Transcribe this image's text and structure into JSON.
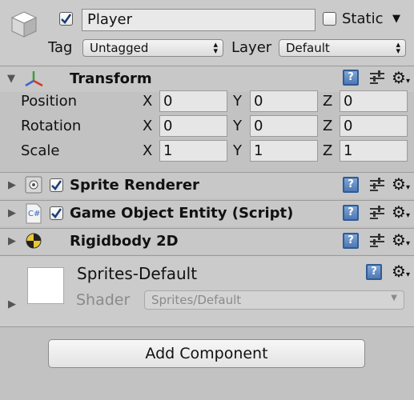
{
  "header": {
    "name_value": "Player",
    "static_label": "Static",
    "tag_label": "Tag",
    "tag_value": "Untagged",
    "layer_label": "Layer",
    "layer_value": "Default"
  },
  "transform": {
    "title": "Transform",
    "rows": [
      {
        "label": "Position",
        "x": "0",
        "y": "0",
        "z": "0"
      },
      {
        "label": "Rotation",
        "x": "0",
        "y": "0",
        "z": "0"
      },
      {
        "label": "Scale",
        "x": "1",
        "y": "1",
        "z": "1"
      }
    ],
    "axes": {
      "x": "X",
      "y": "Y",
      "z": "Z"
    }
  },
  "components": [
    {
      "title": "Sprite Renderer",
      "icon": "sprite-renderer-icon",
      "enabled": true
    },
    {
      "title": "Game Object Entity (Script)",
      "icon": "csharp-script-icon",
      "icon_text": "C#",
      "enabled": true
    },
    {
      "title": "Rigidbody 2D",
      "icon": "rigidbody-2d-icon"
    }
  ],
  "material": {
    "name": "Sprites-Default",
    "shader_label": "Shader",
    "shader_value": "Sprites/Default"
  },
  "add_component_label": "Add Component",
  "icons": {
    "help": "?",
    "gear": "⚙"
  },
  "colors": {
    "panel_bg": "#c2c2c2",
    "help_blue": "#4f78b2"
  }
}
